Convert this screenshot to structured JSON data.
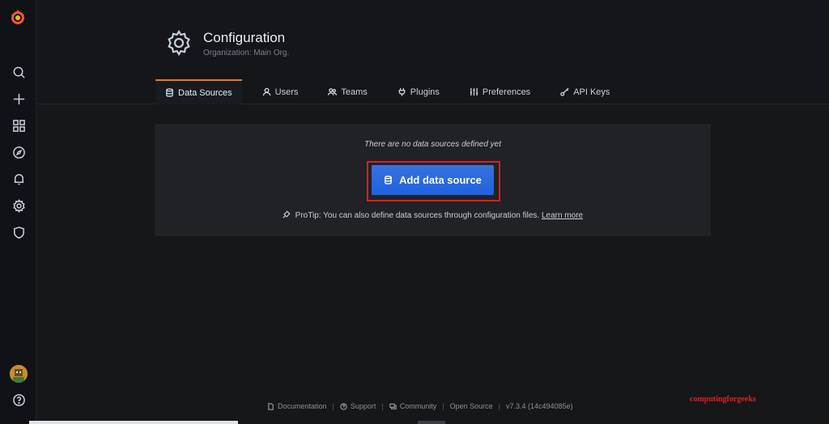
{
  "sidebar": {
    "icons": [
      "grafana-logo-icon",
      "search-icon",
      "plus-icon",
      "dashboards-icon",
      "explore-icon",
      "alerting-icon",
      "gear-icon",
      "shield-icon",
      "avatar",
      "help-icon"
    ]
  },
  "header": {
    "title": "Configuration",
    "subtitle": "Organization: Main Org."
  },
  "tabs": [
    {
      "label": "Data Sources",
      "icon": "database-icon",
      "active": true
    },
    {
      "label": "Users",
      "icon": "user-icon"
    },
    {
      "label": "Teams",
      "icon": "users-icon"
    },
    {
      "label": "Plugins",
      "icon": "plug-icon"
    },
    {
      "label": "Preferences",
      "icon": "sliders-icon"
    },
    {
      "label": "API Keys",
      "icon": "key-icon"
    }
  ],
  "panel": {
    "empty_text": "There are no data sources defined yet",
    "add_button": "Add data source",
    "protip": "ProTip: You can also define data sources through configuration files.",
    "learn_more": "Learn more"
  },
  "footer": {
    "documentation": "Documentation",
    "support": "Support",
    "community": "Community",
    "open_source": "Open Source",
    "version": "v7.3.4 (14c494085e)"
  },
  "watermark": "computingforgeeks",
  "colors": {
    "accent": "#eb7b18",
    "primary_button": "#1f62e0",
    "highlight_border": "#d0232b"
  }
}
